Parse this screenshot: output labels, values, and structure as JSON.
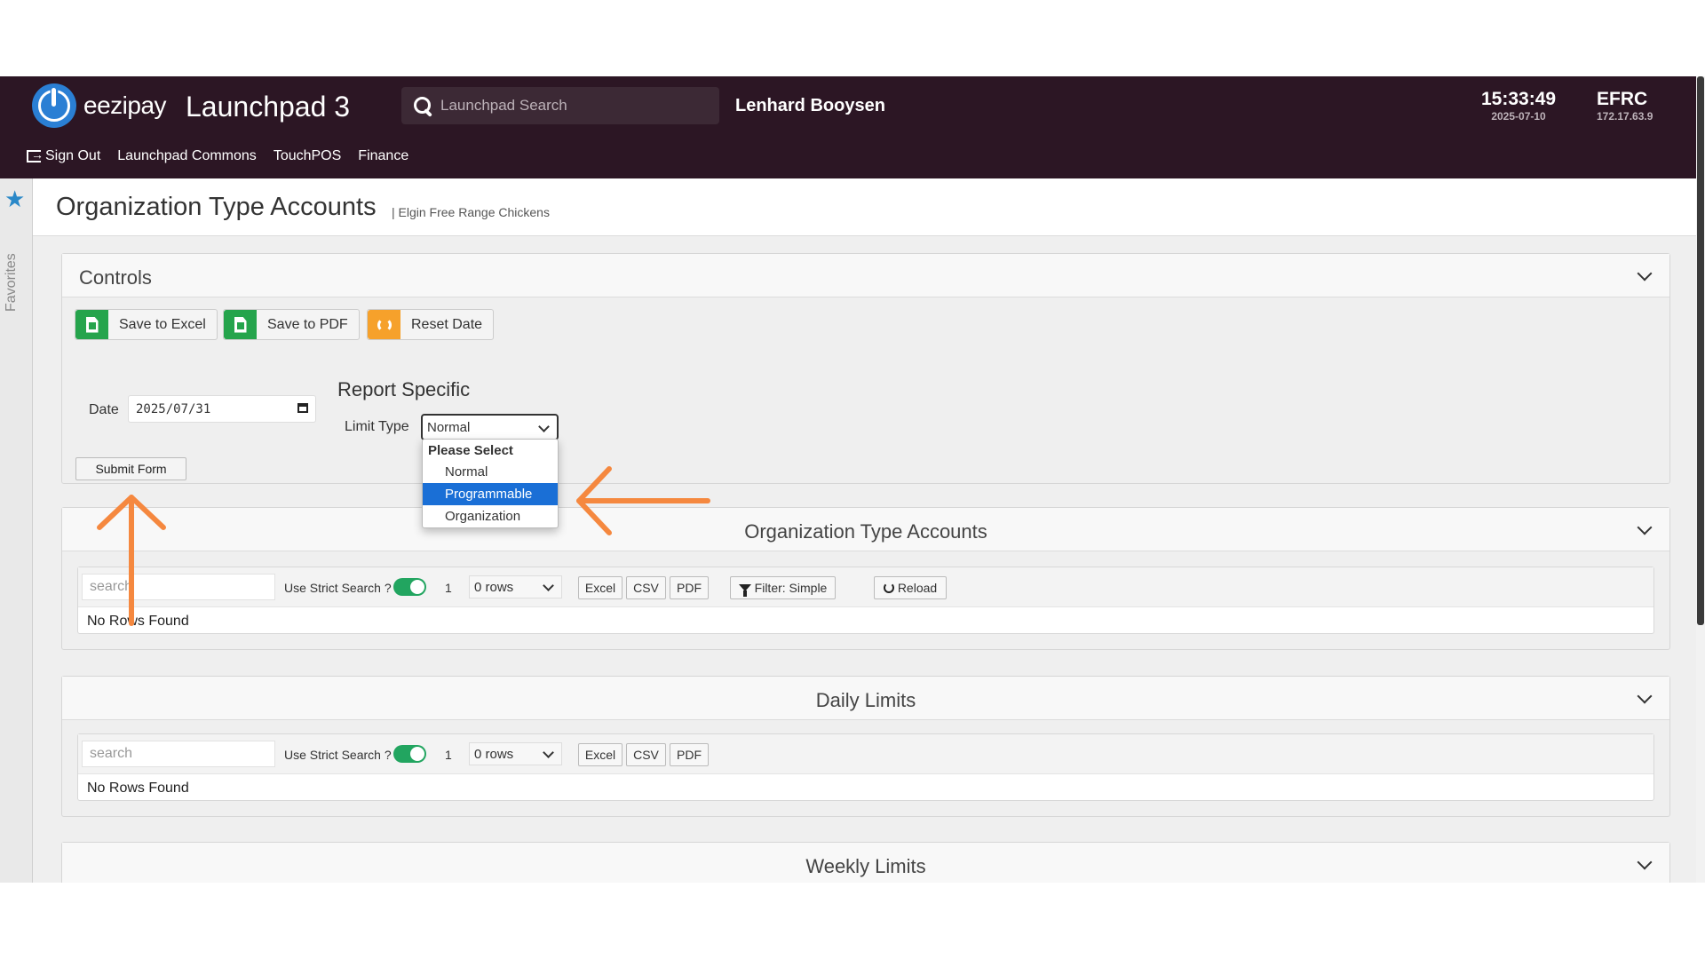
{
  "header": {
    "logo_text": "eezipay",
    "app_title": "Launchpad 3",
    "search_placeholder": "Launchpad Search",
    "user_name": "Lenhard Booysen",
    "time": "15:33:49",
    "date": "2025-07-10",
    "site_code": "EFRC",
    "site_ip": "172.17.63.9",
    "brand_color": "#2c1624"
  },
  "nav": {
    "sign_out": "Sign Out",
    "items": [
      "Launchpad Commons",
      "TouchPOS",
      "Finance"
    ]
  },
  "favorites": {
    "label": "Favorites"
  },
  "page": {
    "title": "Organization Type Accounts",
    "subtitle": "| Elgin Free Range Chickens"
  },
  "controls": {
    "title": "Controls",
    "save_excel": "Save to Excel",
    "save_pdf": "Save to PDF",
    "reset_date": "Reset Date",
    "date_label": "Date",
    "date_value": "2025/07/31",
    "report_specific": "Report Specific",
    "limit_type_label": "Limit Type",
    "limit_type_value": "Normal",
    "submit": "Submit Form",
    "dropdown": {
      "group": "Please Select",
      "options": [
        "Normal",
        "Programmable",
        "Organization"
      ],
      "highlighted": "Programmable"
    }
  },
  "sections": [
    {
      "title": "Organization Type Accounts",
      "search_placeholder": "search",
      "strict_label": "Use Strict Search ?",
      "page": "1",
      "rows": "0 rows",
      "excel": "Excel",
      "csv": "CSV",
      "pdf": "PDF",
      "filter": "Filter: Simple",
      "reload": "Reload",
      "empty": "No Rows Found"
    },
    {
      "title": "Daily Limits",
      "search_placeholder": "search",
      "strict_label": "Use Strict Search ?",
      "page": "1",
      "rows": "0 rows",
      "excel": "Excel",
      "csv": "CSV",
      "pdf": "PDF",
      "empty": "No Rows Found"
    },
    {
      "title": "Weekly Limits"
    }
  ],
  "annotation_color": "#f5883f"
}
